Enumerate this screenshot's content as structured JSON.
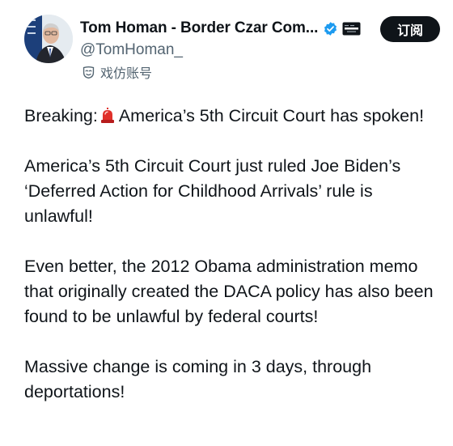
{
  "header": {
    "display_name": "Tom Homan - Border Czar Com...",
    "handle": "@TomHoman_",
    "account_label": "戏仿账号",
    "subscribe_label": "订阅"
  },
  "tweet": {
    "p1_prefix": "Breaking:",
    "p1_rest": "America’s 5th Circuit Court has spoken!",
    "p2": "America’s 5th Circuit Court just ruled Joe Biden’s ‘Deferred Action for Childhood Arrivals’ rule is unlawful!",
    "p3": "Even better, the 2012 Obama administration memo that originally created the DACA policy has also been found to be unlawful by federal courts!",
    "p4": "Massive change is coming in 3 days, through deportations!"
  },
  "icons": {
    "verified": "verified-badge-icon",
    "affiliate": "affiliate-badge-icon",
    "parody": "parody-mask-icon",
    "siren": "police-siren-icon"
  },
  "colors": {
    "verified_blue": "#1d9bf0",
    "text": "#0f1419",
    "muted": "#536471",
    "siren_red": "#e0312b"
  }
}
